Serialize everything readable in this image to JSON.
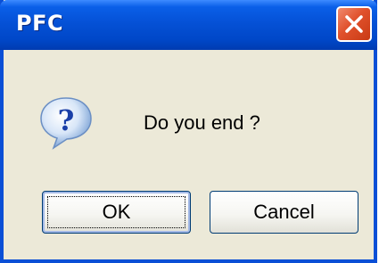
{
  "window": {
    "title": "PFC"
  },
  "dialog": {
    "icon": "question-icon",
    "message": "Do you end ?"
  },
  "buttons": {
    "ok_label": "OK",
    "cancel_label": "Cancel"
  },
  "colors": {
    "titlebar": "#0551d6",
    "close_button": "#e0512c",
    "dialog_background": "#ece9d8"
  }
}
